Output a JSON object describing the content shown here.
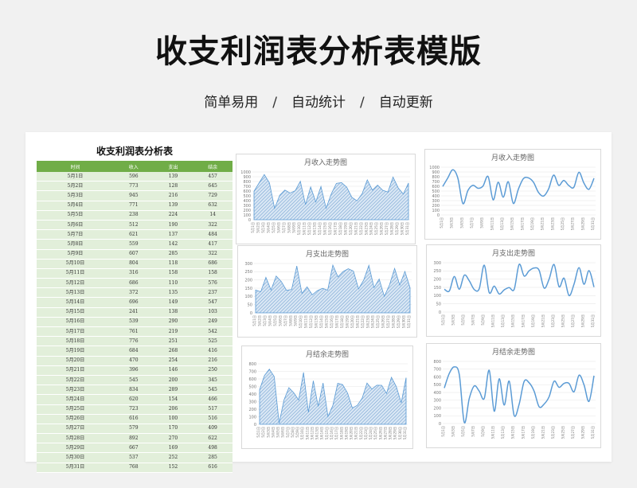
{
  "header": {
    "title": "收支利润表分析表模版",
    "tagline": [
      "简单易用",
      "自动统计",
      "自动更新"
    ],
    "separator": "/"
  },
  "table": {
    "title": "收支利润表分析表",
    "header_color": "#70ad47",
    "row_color": "#e2efda",
    "columns": [
      "时间",
      "收入",
      "支出",
      "结余"
    ],
    "rows": [
      [
        "5月1日",
        "596",
        "139",
        "457"
      ],
      [
        "5月2日",
        "773",
        "128",
        "645"
      ],
      [
        "5月3日",
        "945",
        "216",
        "729"
      ],
      [
        "5月4日",
        "771",
        "139",
        "632"
      ],
      [
        "5月5日",
        "238",
        "224",
        "14"
      ],
      [
        "5月6日",
        "512",
        "190",
        "322"
      ],
      [
        "5月7日",
        "621",
        "137",
        "484"
      ],
      [
        "5月8日",
        "559",
        "142",
        "417"
      ],
      [
        "5月9日",
        "607",
        "285",
        "322"
      ],
      [
        "5月10日",
        "804",
        "118",
        "686"
      ],
      [
        "5月11日",
        "316",
        "158",
        "158"
      ],
      [
        "5月12日",
        "686",
        "110",
        "576"
      ],
      [
        "5月13日",
        "372",
        "135",
        "237"
      ],
      [
        "5月14日",
        "696",
        "149",
        "547"
      ],
      [
        "5月15日",
        "241",
        "138",
        "103"
      ],
      [
        "5月16日",
        "539",
        "290",
        "249"
      ],
      [
        "5月17日",
        "761",
        "219",
        "542"
      ],
      [
        "5月18日",
        "776",
        "251",
        "525"
      ],
      [
        "5月19日",
        "684",
        "268",
        "416"
      ],
      [
        "5月20日",
        "470",
        "254",
        "216"
      ],
      [
        "5月21日",
        "396",
        "146",
        "250"
      ],
      [
        "5月22日",
        "545",
        "200",
        "345"
      ],
      [
        "5月23日",
        "834",
        "289",
        "545"
      ],
      [
        "5月24日",
        "620",
        "154",
        "466"
      ],
      [
        "5月25日",
        "723",
        "206",
        "517"
      ],
      [
        "5月26日",
        "616",
        "100",
        "516"
      ],
      [
        "5月27日",
        "579",
        "170",
        "409"
      ],
      [
        "5月28日",
        "892",
        "270",
        "622"
      ],
      [
        "5月29日",
        "667",
        "169",
        "498"
      ],
      [
        "5月30日",
        "537",
        "252",
        "285"
      ],
      [
        "5月31日",
        "768",
        "152",
        "616"
      ]
    ]
  },
  "chart_data": [
    {
      "type": "area",
      "title": "月收入走势图",
      "series_col": 1,
      "ylim": [
        0,
        1000
      ],
      "yticks": [
        0,
        100,
        200,
        300,
        400,
        500,
        600,
        700,
        800,
        900,
        1000
      ],
      "color": "#5b9bd5"
    },
    {
      "type": "line",
      "title": "月收入走势图",
      "series_col": 1,
      "ylim": [
        0,
        1000
      ],
      "yticks": [
        0,
        100,
        200,
        300,
        400,
        500,
        600,
        700,
        800,
        900,
        1000
      ],
      "color": "#5b9bd5"
    },
    {
      "type": "area",
      "title": "月支出走势图",
      "series_col": 2,
      "ylim": [
        0,
        300
      ],
      "yticks": [
        0,
        50,
        100,
        150,
        200,
        250,
        300
      ],
      "color": "#5b9bd5"
    },
    {
      "type": "line",
      "title": "月支出走势图",
      "series_col": 2,
      "ylim": [
        0,
        300
      ],
      "yticks": [
        0,
        50,
        100,
        150,
        200,
        250,
        300
      ],
      "color": "#5b9bd5"
    },
    {
      "type": "area",
      "title": "月结余走势图",
      "series_col": 3,
      "ylim": [
        0,
        800
      ],
      "yticks": [
        0,
        100,
        200,
        300,
        400,
        500,
        600,
        700,
        800
      ],
      "color": "#5b9bd5"
    },
    {
      "type": "line",
      "title": "月结余走势图",
      "series_col": 3,
      "ylim": [
        0,
        800
      ],
      "yticks": [
        0,
        100,
        200,
        300,
        400,
        500,
        600,
        700,
        800
      ],
      "color": "#5b9bd5"
    }
  ]
}
